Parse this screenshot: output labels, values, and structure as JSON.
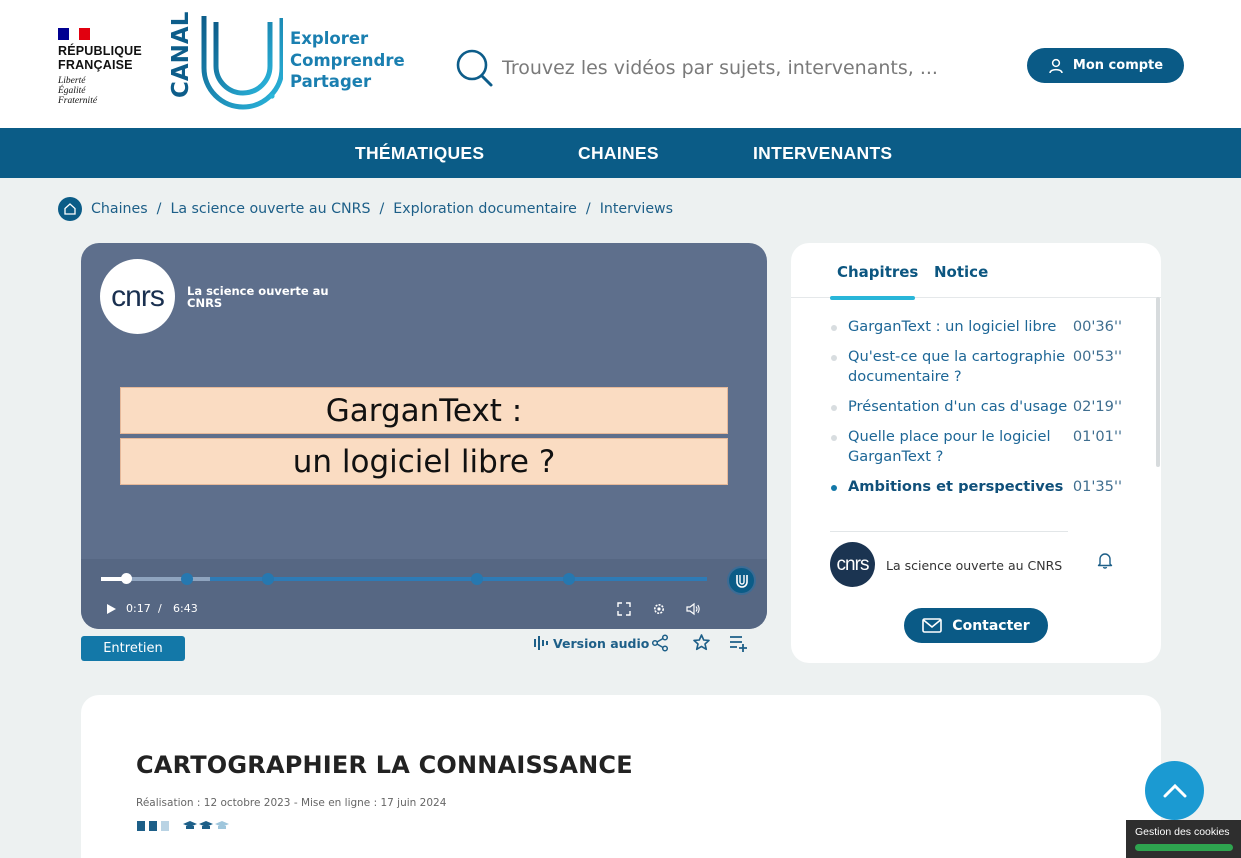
{
  "header": {
    "republic": {
      "line1": "RÉPUBLIQUE",
      "line2": "FRANÇAISE",
      "motto1": "Liberté",
      "motto2": "Égalité",
      "motto3": "Fraternité"
    },
    "logo_text": "CANAL",
    "tagline": [
      "Explorer",
      "Comprendre",
      "Partager"
    ],
    "search_placeholder": "Trouvez les vidéos par sujets, intervenants, ...",
    "account_label": "Mon compte"
  },
  "nav": {
    "items": [
      "THÉMATIQUES",
      "CHAINES",
      "INTERVENANTS"
    ]
  },
  "breadcrumb": [
    "Chaines",
    "La science ouverte au CNRS",
    "Exploration documentaire",
    "Interviews"
  ],
  "breadcrumb_separator": "/",
  "video": {
    "badge_text": "cnrs",
    "channel_overlay": "La science ouverte au CNRS",
    "slide_line1": "GarganText :",
    "slide_line2": "un logiciel libre ?",
    "current_time": "0:17",
    "time_separator": "/",
    "duration": "6:43",
    "progress_fraction": 0.042,
    "buffered_fraction": 0.18
  },
  "tag": "Entretien",
  "actions": {
    "audio_label": "Version audio"
  },
  "panel": {
    "tabs": [
      "Chapitres",
      "Notice"
    ],
    "active_tab": "Chapitres",
    "chapters": [
      {
        "title": "GarganText : un logiciel libre",
        "duration": "00'36''",
        "active": false
      },
      {
        "title": "Qu'est-ce que la cartographie documentaire ?",
        "duration": "00'53''",
        "active": false
      },
      {
        "title": "Présentation d'un cas d'usage",
        "duration": "02'19''",
        "active": false
      },
      {
        "title": "Quelle place pour le logiciel GarganText ?",
        "duration": "01'01''",
        "active": false
      },
      {
        "title": "Ambitions et perspectives",
        "duration": "01'35''",
        "active": true
      }
    ],
    "channel_logo_text": "cnrs",
    "channel_name": "La science ouverte au CNRS",
    "contact_label": "Contacter"
  },
  "info": {
    "title": "CARTOGRAPHIER LA CONNAISSANCE",
    "meta": "Réalisation : 12 octobre 2023 - Mise en ligne : 17 juin 2024"
  },
  "cookies_label": "Gestion des cookies",
  "colors": {
    "primary": "#0a5a86",
    "accent": "#29b6d9",
    "link": "#1d5f88",
    "background": "#edf1f1"
  }
}
